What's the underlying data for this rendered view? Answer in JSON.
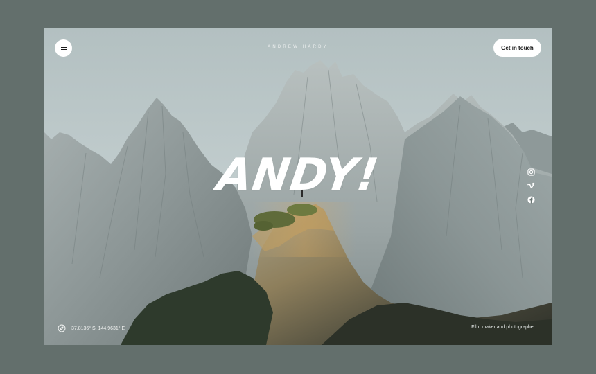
{
  "header": {
    "brand": "ANDREW HARDY",
    "cta_label": "Get in touch",
    "menu_icon": "menu-icon"
  },
  "hero": {
    "title": "ANDY!"
  },
  "social": {
    "icons": [
      "instagram-icon",
      "vimeo-icon",
      "facebook-icon"
    ]
  },
  "footer": {
    "coordinates": "37.8136° S, 144.9631° E",
    "compass_icon": "compass-icon",
    "tagline": "Film maker and photographer"
  },
  "colors": {
    "page_bg": "#636f6c",
    "sky": "#b9c6c7",
    "button_bg": "#ffffff"
  }
}
